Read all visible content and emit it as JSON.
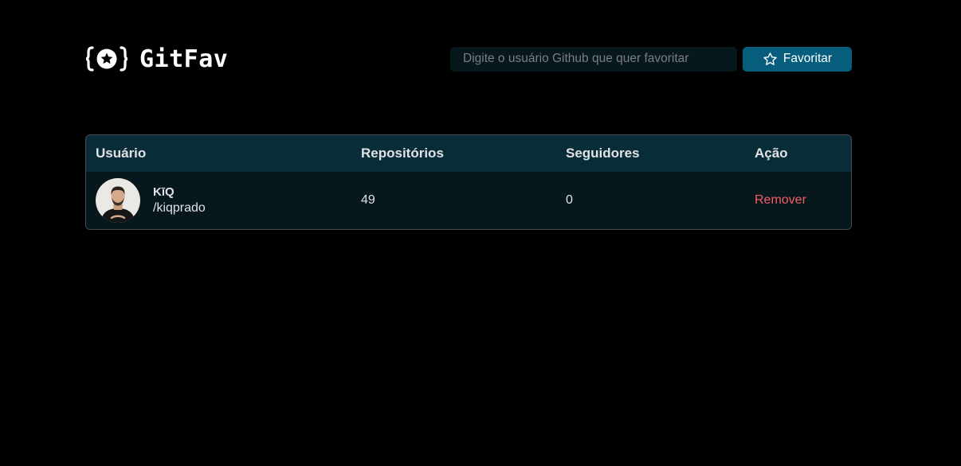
{
  "header": {
    "logo_text": "GitFav",
    "logo_icon": "braces-star-icon",
    "search": {
      "placeholder": "Digite o usuário Github que quer favoritar",
      "value": ""
    },
    "favorite_button": {
      "label": "Favoritar",
      "icon": "star-outline-icon"
    }
  },
  "table": {
    "columns": [
      "Usuário",
      "Repositórios",
      "Seguidores",
      "Ação"
    ],
    "rows": [
      {
        "name": "KīQ",
        "login": "/kiqprado",
        "repositories": "49",
        "followers": "0",
        "action": "Remover"
      }
    ]
  },
  "colors": {
    "background": "#000000",
    "header_row": "#092d38",
    "body_row": "#06181c",
    "button": "#065e7c",
    "remove": "#f75a68"
  }
}
